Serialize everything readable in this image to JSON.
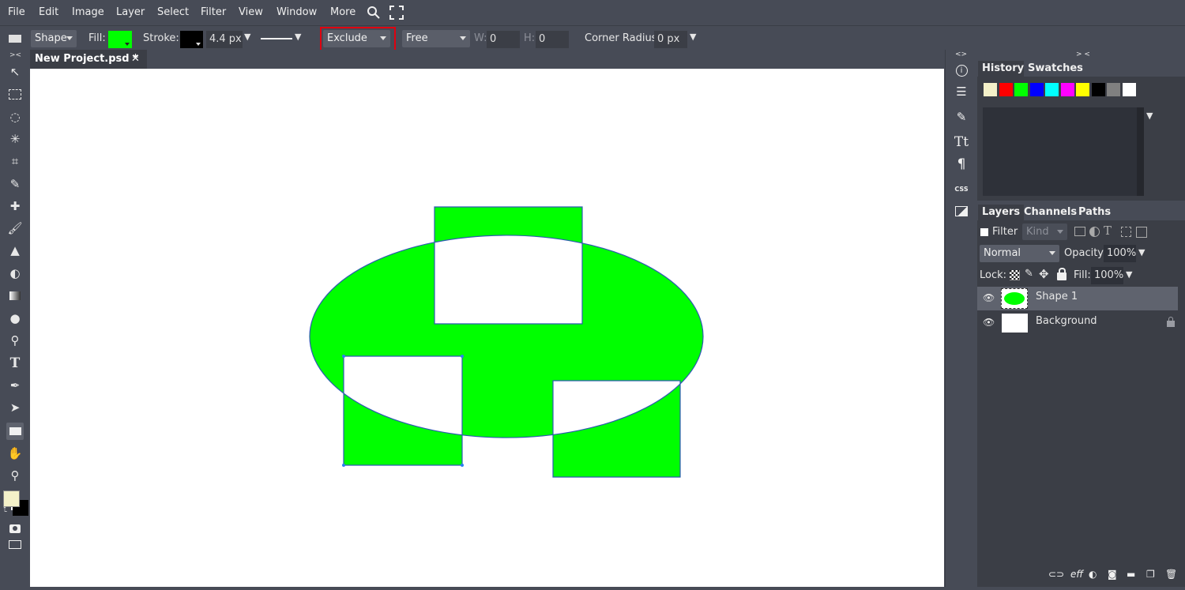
{
  "menu": [
    "File",
    "Edit",
    "Image",
    "Layer",
    "Select",
    "Filter",
    "View",
    "Window",
    "More"
  ],
  "options": {
    "tool_mode": "Shape",
    "fill_label": "Fill:",
    "fill_color": "#00ff00",
    "stroke_label": "Stroke:",
    "stroke_color": "#000000",
    "stroke_width": "4.4 px",
    "combine_mode": "Exclude",
    "constraint": "Free",
    "w_label": "W:",
    "w_value": "0",
    "h_label": "H:",
    "h_value": "0",
    "corner_label": "Corner Radius:",
    "corner_value": "0 px"
  },
  "document": {
    "tab_title": "New Project.psd *",
    "close_glyph": "✕"
  },
  "side_icons": {
    "css_label": "CSS",
    "collapse": "<>",
    "collapse2": "> <"
  },
  "history_panel": {
    "tab_history": "History",
    "tab_swatches": "Swatches",
    "swatches": [
      "#f4f1c9",
      "#ff0000",
      "#00ff00",
      "#0000ff",
      "#00ffff",
      "#ff00ff",
      "#ffff00",
      "#000000",
      "#808080",
      "#ffffff"
    ]
  },
  "layers_panel": {
    "tab_layers": "Layers",
    "tab_channels": "Channels",
    "tab_paths": "Paths",
    "filter_label": "Filter",
    "kind_label": "Kind",
    "blend_mode": "Normal",
    "opacity_label": "Opacity:",
    "opacity_value": "100%",
    "lock_label": "Lock:",
    "fill_label": "Fill:",
    "fill_value": "100%",
    "layers": [
      {
        "name": "Shape 1",
        "selected": true
      },
      {
        "name": "Background",
        "selected": false
      }
    ],
    "bottom_eff": "eff"
  },
  "colors": {
    "foreground": "#f4f1c9",
    "background": "#000000",
    "shape_fill": "#00ff00",
    "highlight": "#e0000f"
  }
}
